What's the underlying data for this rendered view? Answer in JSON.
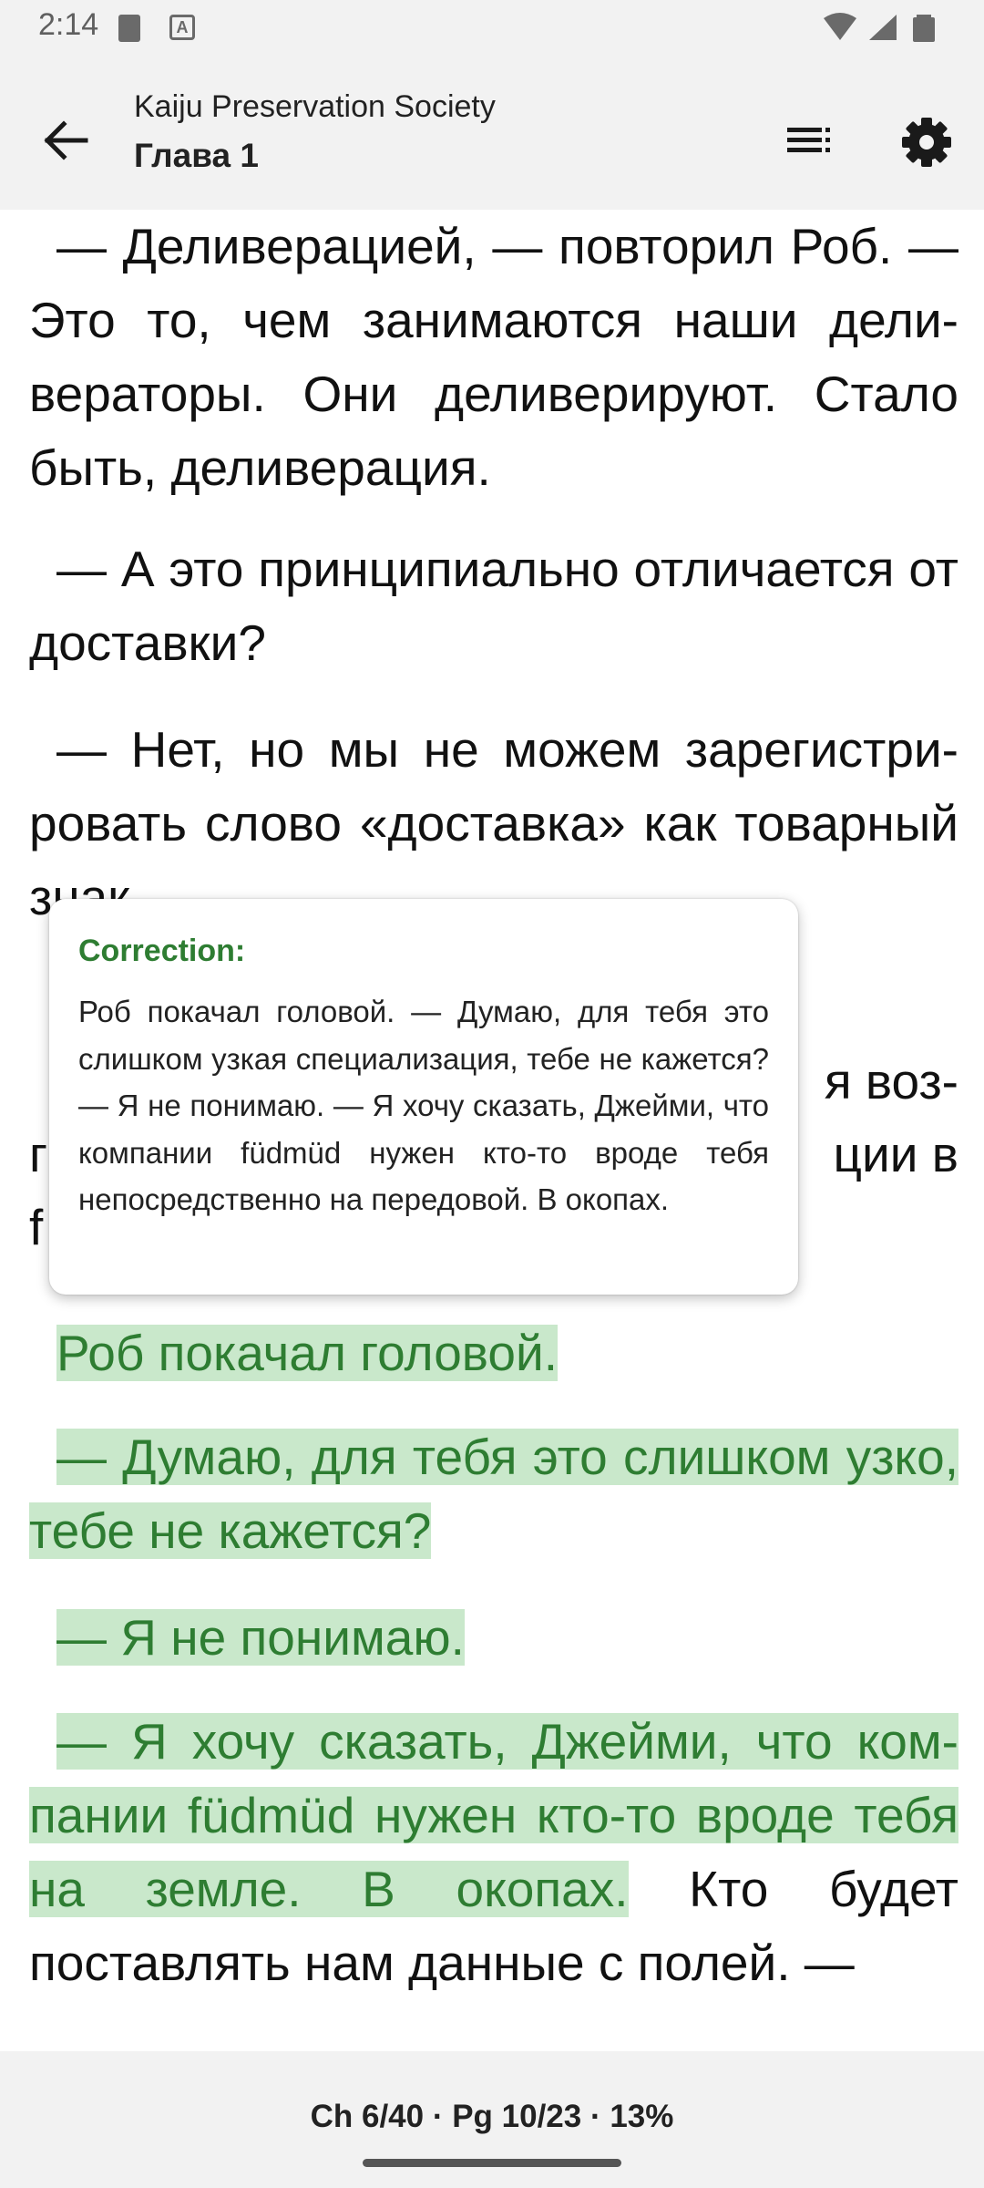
{
  "status_bar": {
    "time": "2:14"
  },
  "header": {
    "book_title": "Kaiju Preservation Society",
    "chapter_title": "Глава 1"
  },
  "reader": {
    "paragraphs": [
      "— Деливерацией, — повторил Роб. — Это то, чем занимаются наши дели­вераторы. Они деливерируют. Стало быть, деливерация.",
      "— А это принципиально отличается от доставки?",
      "— Нет, но мы не можем зарегистри­ровать слово «доставка» как товар­ный знак.",
      "—"
    ],
    "partial_line_right_1": "я воз-",
    "partial_line_right_2": "ции в",
    "partial_line_left_2": "г",
    "partial_line_left_3": "f",
    "highlighted": [
      "Роб покачал головой.",
      "— Думаю, для тебя это слишком узко, тебе не кажется?",
      "— Я не понимаю.",
      "— Я хочу сказать, Джейми, что ком­пании füdmüd нужен кто-то вроде тебя на земле. В окопах."
    ],
    "after_highlight": " Кто будет поставлять нам данные с полей. —"
  },
  "popup": {
    "title": "Correction:",
    "text": "Роб покачал головой. — Думаю, для тебя это слишком узкая специализация, тебе не кажется? — Я не понимаю. — Я хочу сказать, Джейми, что компании füdmüd нужен кто-то вроде тебя непосредственно на передовой. В окопах."
  },
  "footer": {
    "progress": "Ch 6/40 · Pg 10/23 · 13%"
  },
  "colors": {
    "accent_green": "#2e7d32",
    "highlight_bg": "#c9e8cb",
    "chrome_bg": "#f2f2f2"
  },
  "icons": [
    "sd-card-icon",
    "a-notification-icon",
    "wifi-icon",
    "signal-icon",
    "battery-icon",
    "back-arrow-icon",
    "table-of-contents-icon",
    "settings-gear-icon"
  ]
}
